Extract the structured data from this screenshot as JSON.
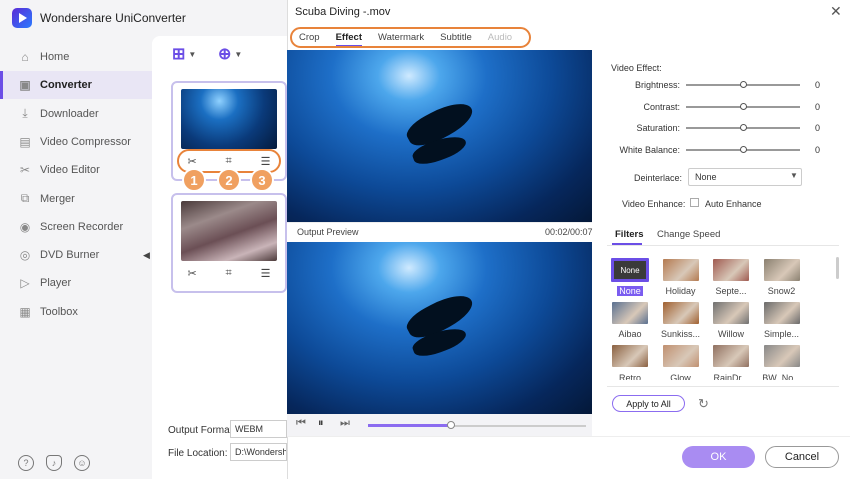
{
  "app": {
    "title": "Wondershare UniConverter"
  },
  "sidebar": {
    "items": [
      {
        "label": "Home",
        "icon": "home-icon",
        "glyph": "⌂"
      },
      {
        "label": "Converter",
        "icon": "converter-icon",
        "glyph": "▣"
      },
      {
        "label": "Downloader",
        "icon": "download-icon",
        "glyph": "⤓"
      },
      {
        "label": "Video Compressor",
        "icon": "compress-icon",
        "glyph": "▤"
      },
      {
        "label": "Video Editor",
        "icon": "scissors-icon",
        "glyph": "✂"
      },
      {
        "label": "Merger",
        "icon": "merge-icon",
        "glyph": "⧉"
      },
      {
        "label": "Screen Recorder",
        "icon": "record-icon",
        "glyph": "◉"
      },
      {
        "label": "DVD Burner",
        "icon": "disc-icon",
        "glyph": "◎"
      },
      {
        "label": "Player",
        "icon": "play-icon",
        "glyph": "▷"
      },
      {
        "label": "Toolbox",
        "icon": "grid-icon",
        "glyph": "▦"
      }
    ],
    "active": "Converter"
  },
  "badges": [
    "1",
    "2",
    "3"
  ],
  "output": {
    "format_label": "Output Format:",
    "format_value": "WEBM",
    "location_label": "File Location:",
    "location_value": "D:\\Wondershare"
  },
  "dialog": {
    "title": "Scuba Diving -.mov",
    "tabs": [
      {
        "label": "Crop",
        "state": "normal"
      },
      {
        "label": "Effect",
        "state": "active"
      },
      {
        "label": "Watermark",
        "state": "normal"
      },
      {
        "label": "Subtitle",
        "state": "normal"
      },
      {
        "label": "Audio",
        "state": "disabled"
      }
    ],
    "preview_label": "Output Preview",
    "time": "00:02/00:07",
    "seek_progress": 0.38,
    "video_effect_title": "Video Effect:",
    "sliders": [
      {
        "label": "Brightness:",
        "value": "0"
      },
      {
        "label": "Contrast:",
        "value": "0"
      },
      {
        "label": "Saturation:",
        "value": "0"
      },
      {
        "label": "White Balance:",
        "value": "0"
      }
    ],
    "deinterlace_label": "Deinterlace:",
    "deinterlace_value": "None",
    "enhance_label": "Video Enhance:",
    "enhance_option": "Auto Enhance",
    "filter_tabs": {
      "filters": "Filters",
      "speed": "Change Speed"
    },
    "filters": [
      {
        "label": "None",
        "color": "#444"
      },
      {
        "label": "Holiday",
        "color": "#b47a50"
      },
      {
        "label": "Septe...",
        "color": "#a05a50"
      },
      {
        "label": "Snow2",
        "color": "#8a8070"
      },
      {
        "label": "Aibao",
        "color": "#5a7090"
      },
      {
        "label": "Sunkiss...",
        "color": "#a06030"
      },
      {
        "label": "Willow",
        "color": "#707070"
      },
      {
        "label": "Simple...",
        "color": "#6a6a6a"
      },
      {
        "label": "Retro",
        "color": "#8a6040"
      },
      {
        "label": "Glow",
        "color": "#c09070"
      },
      {
        "label": "RainDr...",
        "color": "#907060"
      },
      {
        "label": "BW_No...",
        "color": "#888"
      }
    ],
    "apply_label": "Apply to All",
    "ok_label": "OK",
    "cancel_label": "Cancel"
  },
  "colors": {
    "accent": "#6b4ee6",
    "highlight": "#e8833a",
    "badge": "#f0a060"
  }
}
